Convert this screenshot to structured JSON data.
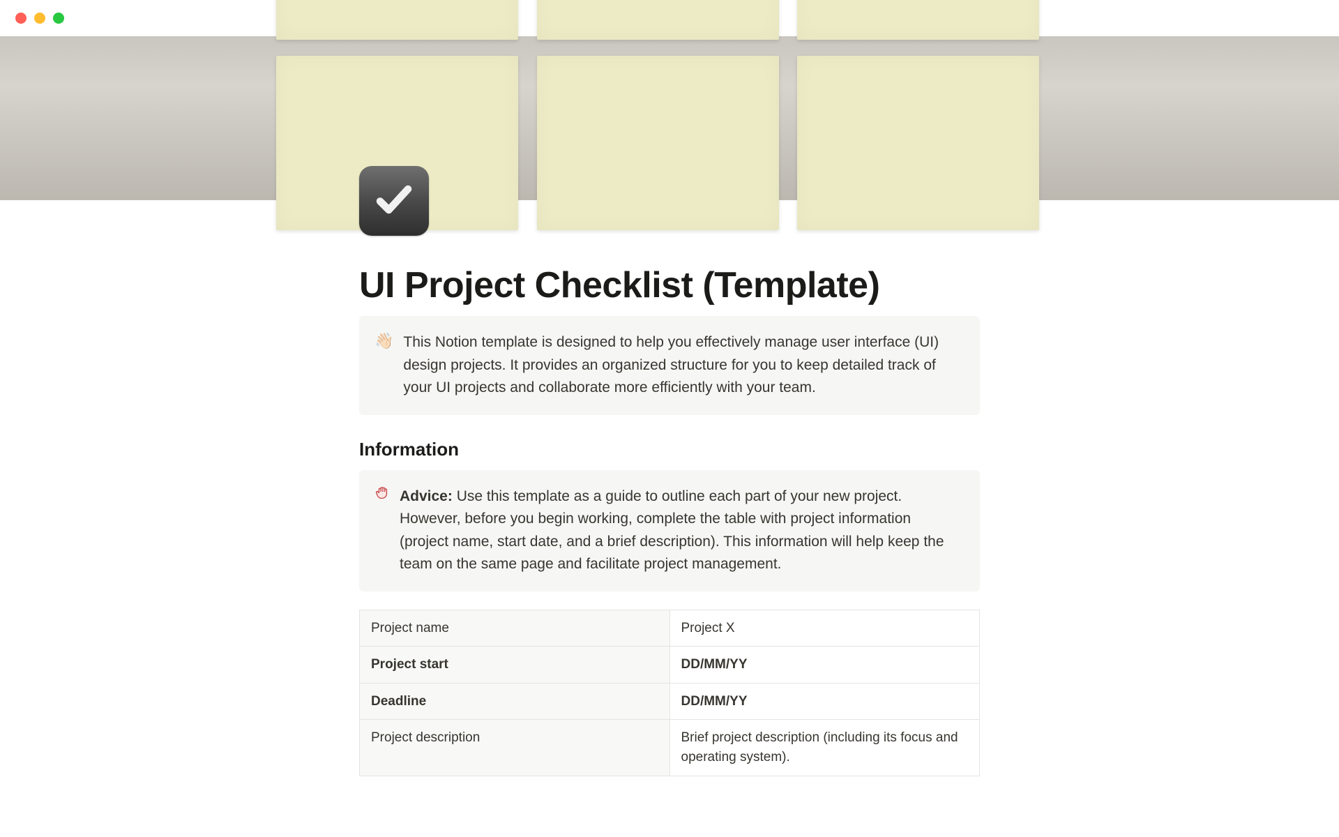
{
  "page": {
    "title": "UI Project Checklist (Template)"
  },
  "intro_callout": {
    "emoji": "👋🏻",
    "text": "This Notion template is designed to help you effectively manage user interface (UI) design projects. It provides an organized structure for you to keep detailed track of your UI projects and collaborate more efficiently with your team."
  },
  "section": {
    "heading": "Information"
  },
  "advice_callout": {
    "emoji": "✋",
    "label": "Advice:",
    "text": " Use this template as a guide to outline each part of your new project. However, before you begin working, complete the table with project information (project name, start date, and a brief description). This information will help keep the team on the same page and facilitate project management."
  },
  "info_table": {
    "rows": [
      {
        "label": "Project name",
        "value": "Project X",
        "bold": false
      },
      {
        "label": "Project start",
        "value": "DD/MM/YY",
        "bold": true
      },
      {
        "label": "Deadline",
        "value": "DD/MM/YY",
        "bold": true
      },
      {
        "label": "Project description",
        "value": "Brief project description (including its focus and operating system).",
        "bold": false
      }
    ]
  }
}
